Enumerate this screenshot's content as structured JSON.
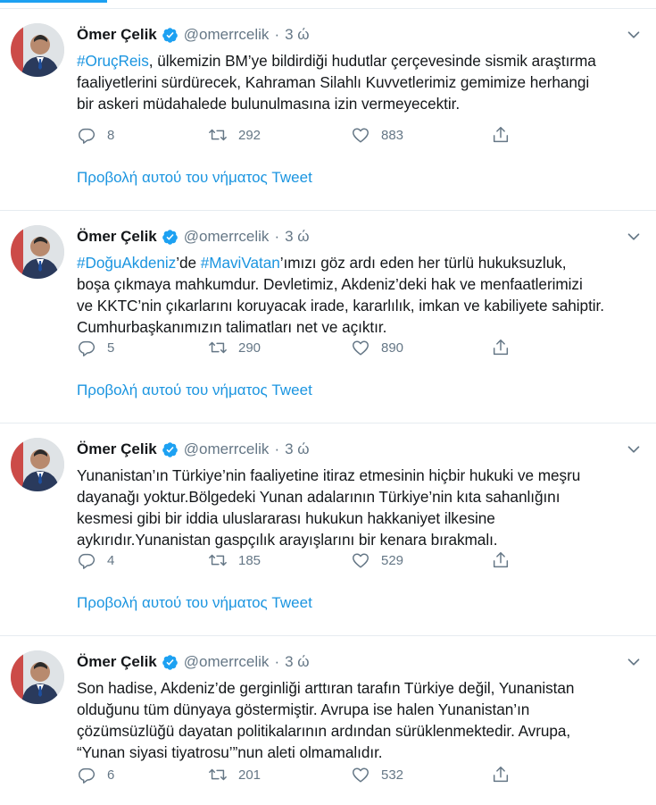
{
  "colors": {
    "accent": "#1da1f2",
    "link": "#1b95e0",
    "muted": "#657786",
    "divider": "#e6ecf0"
  },
  "tweets": [
    {
      "author_name": "Ömer Çelik",
      "handle": "@omerrcelik",
      "separator": "·",
      "time": "3 ώ",
      "lines": [
        [
          {
            "t": "#OruçReis",
            "tag": true
          },
          {
            "t": ", ülkemizin BM’ye bildirdiği hudutlar çerçevesinde sismik araştırma"
          }
        ],
        [
          {
            "t": "faaliyetlerini sürdürecek, Kahraman Silahlı Kuvvetlerimiz gemimize herhangi"
          }
        ],
        [
          {
            "t": "bir askeri müdahalede bulunulmasına izin vermeyecektir."
          }
        ]
      ],
      "replies": "8",
      "retweets": "292",
      "likes": "883",
      "thread_link": "Προβολή αυτού του νήματος Tweet"
    },
    {
      "author_name": "Ömer Çelik",
      "handle": "@omerrcelik",
      "separator": "·",
      "time": "3 ώ",
      "lines": [
        [
          {
            "t": "#DoğuAkdeniz",
            "tag": true
          },
          {
            "t": "’de "
          },
          {
            "t": "#MaviVatan",
            "tag": true
          },
          {
            "t": "’ımızı göz ardı eden her türlü hukuksuzluk,"
          }
        ],
        [
          {
            "t": "boşa çıkmaya mahkumdur. Devletimiz, Akdeniz’deki hak ve menfaatlerimizi"
          }
        ],
        [
          {
            "t": "ve KKTC’nin çıkarlarını koruyacak irade, kararlılık, imkan ve kabiliyete sahiptir."
          }
        ],
        [
          {
            "t": "Cumhurbaşkanımızın talimatları net ve açıktır."
          }
        ]
      ],
      "replies": "5",
      "retweets": "290",
      "likes": "890",
      "thread_link": "Προβολή αυτού του νήματος Tweet"
    },
    {
      "author_name": "Ömer Çelik",
      "handle": "@omerrcelik",
      "separator": "·",
      "time": "3 ώ",
      "lines": [
        [
          {
            "t": "Yunanistan’ın Türkiye’nin faaliyetine itiraz etmesinin hiçbir hukuki ve meşru"
          }
        ],
        [
          {
            "t": "dayanağı yoktur.Bölgedeki Yunan adalarının Türkiye’nin kıta sahanlığını"
          }
        ],
        [
          {
            "t": "kesmesi gibi bir iddia uluslararası hukukun hakkaniyet ilkesine"
          }
        ],
        [
          {
            "t": "aykırıdır.Yunanistan gaspçılık arayışlarını bir kenara bırakmalı."
          }
        ]
      ],
      "replies": "4",
      "retweets": "185",
      "likes": "529",
      "thread_link": "Προβολή αυτού του νήματος Tweet"
    },
    {
      "author_name": "Ömer Çelik",
      "handle": "@omerrcelik",
      "separator": "·",
      "time": "3 ώ",
      "lines": [
        [
          {
            "t": "Son hadise, Akdeniz’de gerginliği arttıran tarafın Türkiye değil, Yunanistan"
          }
        ],
        [
          {
            "t": "olduğunu tüm dünyaya göstermiştir. Avrupa ise halen Yunanistan’ın"
          }
        ],
        [
          {
            "t": "çözümsüzlüğü dayatan politikalarının ardından sürüklenmektedir. Avrupa,"
          }
        ],
        [
          {
            "t": "“Yunan siyasi tiyatrosu’”nun aleti olmamalıdır."
          }
        ]
      ],
      "replies": "6",
      "retweets": "201",
      "likes": "532",
      "thread_link": ""
    }
  ],
  "icons": {
    "verified": "verified-badge-icon",
    "chevron": "chevron-down-icon",
    "reply": "reply-icon",
    "retweet": "retweet-icon",
    "like": "heart-icon",
    "share": "share-icon"
  }
}
